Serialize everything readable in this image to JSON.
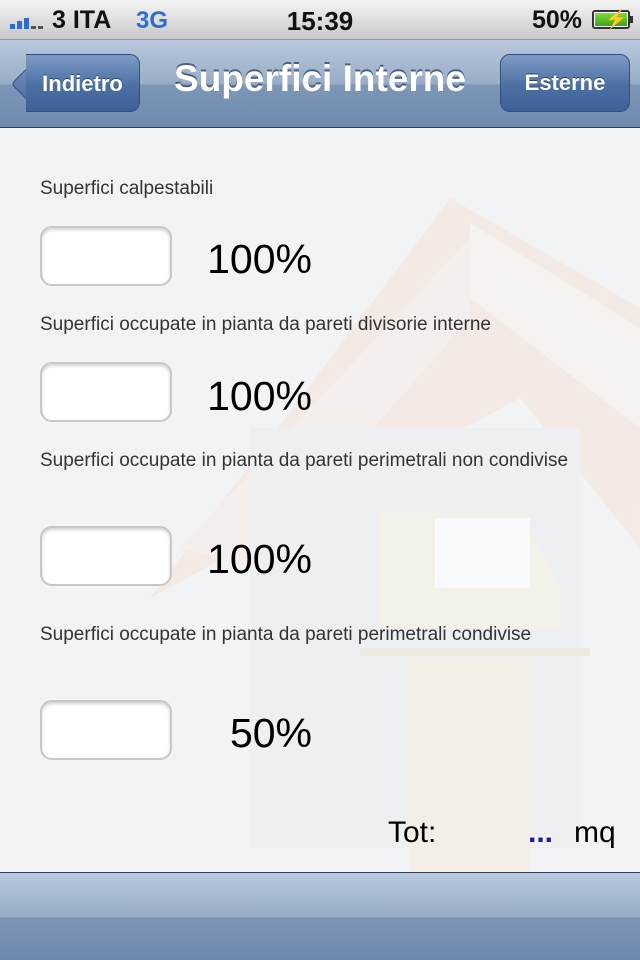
{
  "status_bar": {
    "carrier": "3 ITA",
    "network": "3G",
    "time": "15:39",
    "battery": "50%",
    "signal_icon": "signal-bars-icon",
    "battery_icon": "battery-charging-icon"
  },
  "nav": {
    "back_label": "Indietro",
    "title": "Superfici Interne",
    "right_label": "Esterne"
  },
  "rows": [
    {
      "label": "Superfici calpestabili",
      "percent": "100%"
    },
    {
      "label": "Superfici occupate in pianta da pareti  divisorie interne",
      "percent": "100%"
    },
    {
      "label": "Superfici occupate in pianta da pareti perimetrali non condivise",
      "percent": "100%"
    },
    {
      "label": "Superfici occupate in pianta da pareti perimetrali condivise",
      "percent": "50%"
    }
  ],
  "total": {
    "label": "Tot:",
    "value": "...",
    "unit": "mq"
  },
  "colors": {
    "nav_blue": "#6f8bb0",
    "button_blue": "#4c6fa3",
    "value_blue": "#1a1aa6"
  }
}
